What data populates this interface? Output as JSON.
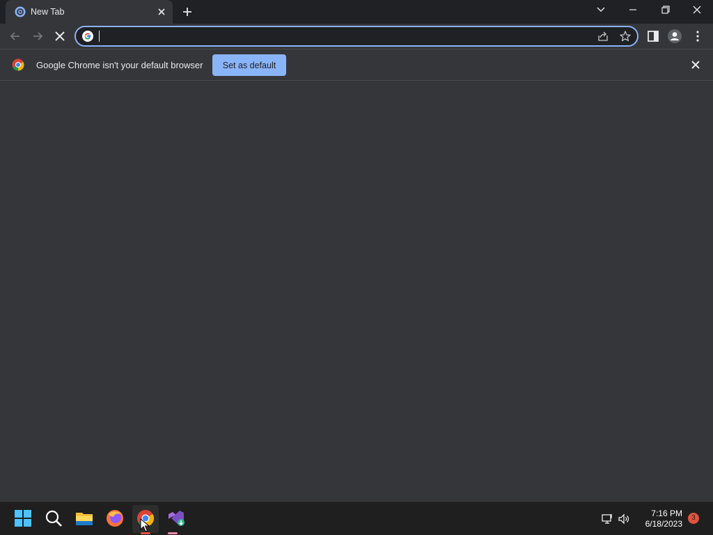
{
  "browser": {
    "tab": {
      "title": "New Tab",
      "favicon": "chrome-new-tab-icon"
    },
    "omnibox": {
      "value": "",
      "placeholder": ""
    },
    "infobar": {
      "message": "Google Chrome isn't your default browser",
      "button_label": "Set as default"
    }
  },
  "taskbar": {
    "apps": [
      "windows-start-icon",
      "search-icon",
      "file-explorer-icon",
      "firefox-icon",
      "chrome-icon",
      "visual-studio-installer-icon"
    ],
    "clock": {
      "time": "7:16 PM",
      "date": "6/18/2023"
    },
    "notification_count": "3"
  },
  "colors": {
    "accent": "#8ab4f8",
    "background": "#35363a",
    "tabstrip": "#202124",
    "taskbar": "#1f1f1f",
    "notification": "#e0533d"
  }
}
